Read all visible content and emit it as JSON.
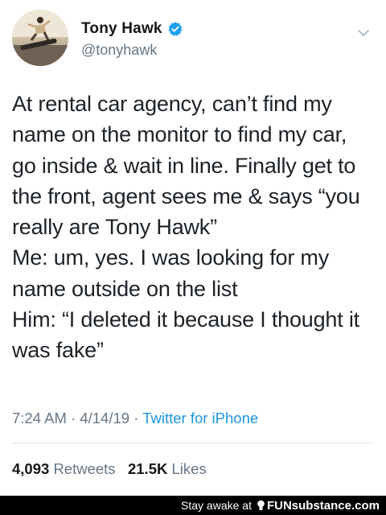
{
  "tweet": {
    "author": {
      "display_name": "Tony Hawk",
      "handle": "@tonyhawk",
      "verified_icon": "verified-badge-icon",
      "accent_color": "#1da1f2"
    },
    "menu_icon": "chevron-down-icon",
    "body_lines": [
      "At rental car agency, can’t find my",
      "name on the monitor to find my car,",
      "go inside & wait in line. Finally get to",
      "the front, agent sees me & says “you",
      "really are Tony Hawk”",
      "Me: um, yes. I was looking for my",
      "name outside on the list",
      "Him: “I deleted it because I thought it",
      "was fake”"
    ],
    "time": "7:24 AM",
    "date": "4/14/19",
    "separator": "·",
    "source": "Twitter for iPhone",
    "source_color": "#1b95e0",
    "stats": {
      "retweets_count": "4,093",
      "retweets_label": "Retweets",
      "likes_count": "21.5K",
      "likes_label": "Likes"
    }
  },
  "footer": {
    "tagline": "Stay awake at",
    "logo_text": "FUNsubstance.com",
    "background": "#000000"
  }
}
